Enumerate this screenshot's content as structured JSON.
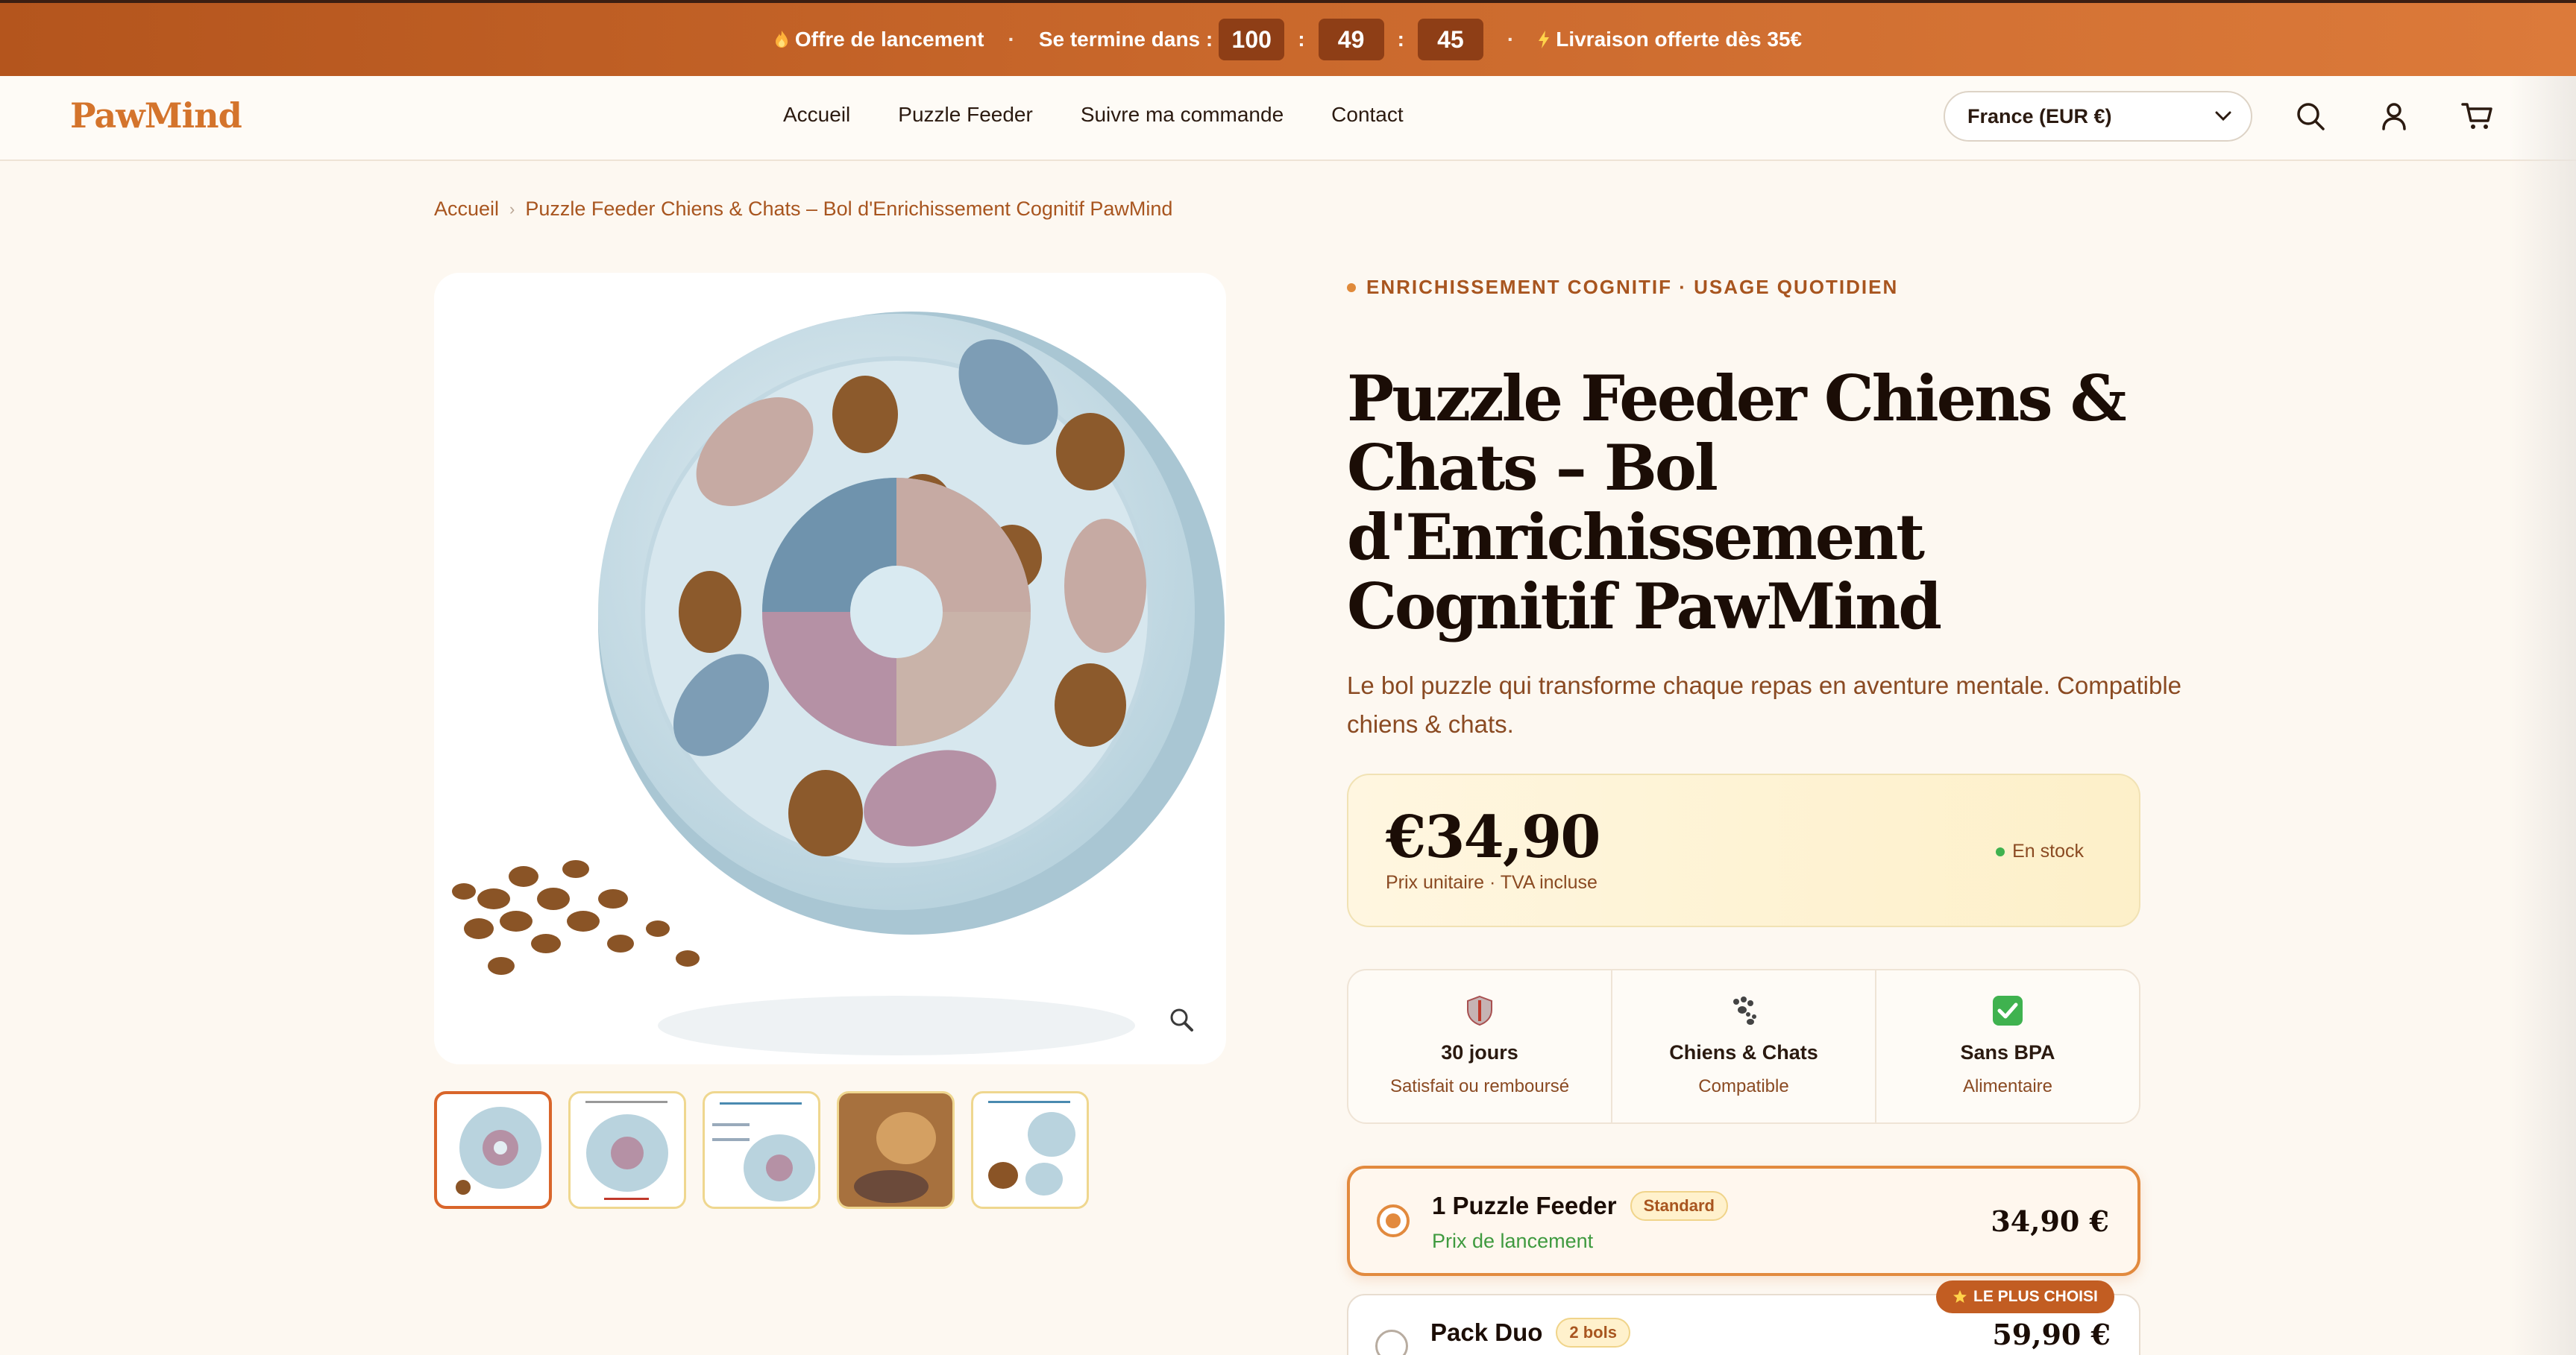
{
  "announcement": {
    "offer": "Offre de lancement",
    "ends_in": "Se termine dans :",
    "hours": "100",
    "minutes": "49",
    "seconds": "45",
    "sep": ":",
    "shipping": "Livraison offerte dès 35€"
  },
  "header": {
    "logo": "PawMind",
    "nav": [
      "Accueil",
      "Puzzle Feeder",
      "Suivre ma commande",
      "Contact"
    ],
    "country": "France (EUR €)"
  },
  "breadcrumb": {
    "home": "Accueil",
    "current": "Puzzle Feeder Chiens & Chats – Bol d'Enrichissement Cognitif PawMind"
  },
  "product": {
    "eyebrow": "ENRICHISSEMENT COGNITIF · USAGE QUOTIDIEN",
    "title": "Puzzle Feeder Chiens & Chats – Bol d'Enrichissement Cognitif PawMind",
    "subtitle": "Le bol puzzle qui transforme chaque repas en aventure mentale. Compatible chiens & chats.",
    "price": "€34,90",
    "price_note": "Prix unitaire · TVA incluse",
    "stock": "En stock",
    "thumb_count": 5
  },
  "features": [
    {
      "icon": "shield-icon",
      "title": "30 jours",
      "sub": "Satisfait ou remboursé"
    },
    {
      "icon": "paw-icon",
      "title": "Chiens & Chats",
      "sub": "Compatible"
    },
    {
      "icon": "check-icon",
      "title": "Sans BPA",
      "sub": "Alimentaire"
    }
  ],
  "options": [
    {
      "name": "1 Puzzle Feeder",
      "tag": "Standard",
      "sub": "Prix de lancement",
      "price": "34,90 €",
      "selected": true
    },
    {
      "name": "Pack Duo",
      "tag": "2 bols",
      "price": "59,90 €",
      "ribbon": "LE PLUS CHOISI",
      "selected": false
    }
  ],
  "colors": {
    "accent": "#d9652a",
    "brand": "#d4742c",
    "text": "#1b0d06",
    "muted": "#8a4a22",
    "success": "#3fb24f"
  }
}
